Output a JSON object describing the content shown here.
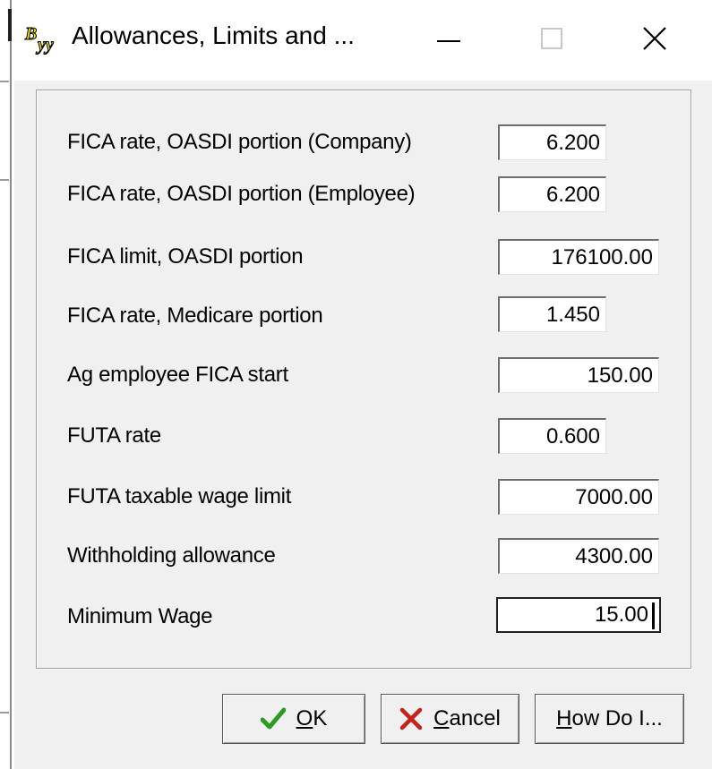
{
  "window": {
    "title": "Allowances, Limits and ...",
    "app_icon": "byw-logo-icon",
    "controls": [
      "minimize-icon",
      "maximize-icon",
      "close-icon"
    ]
  },
  "fields": [
    {
      "label": "FICA rate, OASDI portion (Company)",
      "value": "6.200"
    },
    {
      "label": "FICA rate, OASDI portion (Employee)",
      "value": "6.200"
    },
    {
      "label": "FICA limit, OASDI portion",
      "value": "176100.00"
    },
    {
      "label": "FICA rate, Medicare portion",
      "value": "1.450"
    },
    {
      "label": "Ag employee FICA start",
      "value": "150.00"
    },
    {
      "label": "FUTA rate",
      "value": "0.600"
    },
    {
      "label": "FUTA taxable wage limit",
      "value": "7000.00"
    },
    {
      "label": "Withholding allowance",
      "value": "4300.00"
    },
    {
      "label": "Minimum Wage",
      "value": "15.00"
    }
  ],
  "buttons": {
    "ok": {
      "mnemonic": "O",
      "rest": "K",
      "icon": "checkmark-icon"
    },
    "cancel": {
      "mnemonic": "C",
      "rest": "ancel",
      "icon": "x-icon"
    },
    "how": {
      "mnemonic": "H",
      "rest": "ow Do I..."
    }
  },
  "colors": {
    "ok_check": "#2e9a22",
    "cancel_x": "#c8201a",
    "logo_yellow": "#f0e000"
  }
}
